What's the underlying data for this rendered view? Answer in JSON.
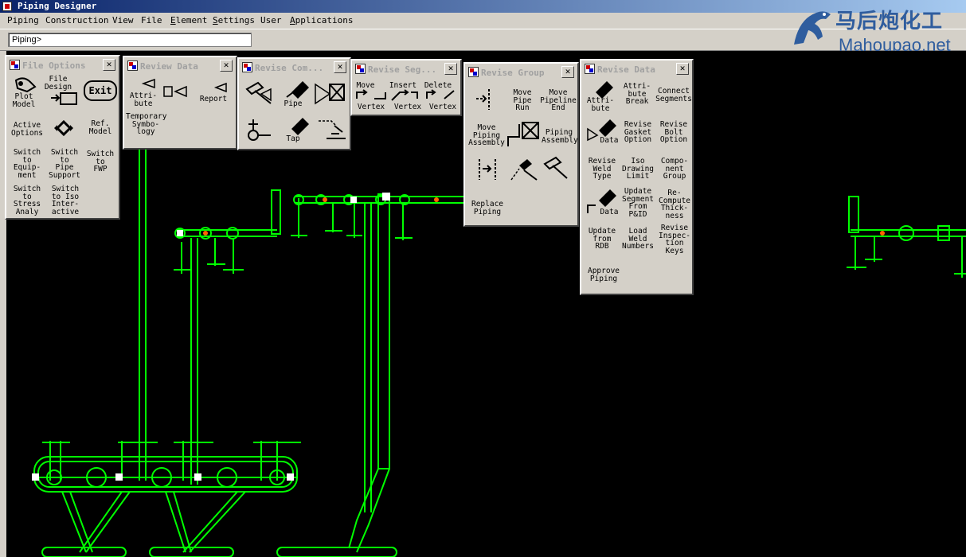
{
  "window": {
    "title": "Piping Designer"
  },
  "menu": [
    "Piping",
    "Construction",
    "View",
    "File",
    "Element",
    "Settings",
    "User",
    "Applications"
  ],
  "command_line": {
    "value": "Piping>"
  },
  "watermark": {
    "cn": "马后炮化工",
    "en": "Mahoupao.net"
  },
  "palettes": {
    "file_options": {
      "title": "File Options",
      "buttons": [
        "Plot\nModel",
        "File\nDesign",
        "Ref.\nModel",
        "Active\nOptions",
        "Switch\nto\nEquip-\nment",
        "Switch\nto\nPipe\nSupport",
        "Switch\nto\nFWP",
        "Switch\nto\nStress\nAnaly",
        "Switch\nto Iso\nInter-\nactive"
      ],
      "exit_label": "Exit"
    },
    "review_data": {
      "title": "Review Data",
      "buttons": [
        "Attri-\nbute",
        "Report",
        "Temporary\nSymbo-\nlogy"
      ]
    },
    "revise_component": {
      "title": "Revise Com...",
      "buttons": [
        "Pipe",
        "Tap"
      ]
    },
    "revise_segment": {
      "title": "Revise Seg...",
      "buttons": [
        "Move",
        "Insert",
        "Delete",
        "Vertex",
        "Vertex",
        "Vertex"
      ]
    },
    "revise_group": {
      "title": "Revise Group",
      "buttons": [
        "Move\nPipe\nRun",
        "Move\nPipeline\nEnd",
        "Move\nPiping\nAssembly",
        "Piping\nAssembly",
        "Replace\nPiping"
      ]
    },
    "revise_data": {
      "title": "Revise Data",
      "buttons": [
        "Attri-\nbute",
        "Attri-\nbute\nBreak",
        "Connect\nSegments",
        "Data",
        "Revise\nGasket\nOption",
        "Revise\nBolt\nOption",
        "Revise\nWeld\nType",
        "Iso\nDrawing\nLimit",
        "Compo-\nnent\nGroup",
        "Data",
        "Update\nSegment\nFrom\nP&ID",
        "Re-\nCompute\nThick-\nness",
        "Update\nfrom\nRDB",
        "Load\nWeld\nNumbers",
        "Revise\nInspec-\ntion\nKeys",
        "Approve\nPiping"
      ]
    },
    "review_data_2": {
      "title": "Review Data"
    }
  },
  "colors": {
    "pipe": "#00ff00",
    "valve_accent": "#ff6600",
    "canvas": "#000000",
    "watermark": "#2f5d9e"
  }
}
